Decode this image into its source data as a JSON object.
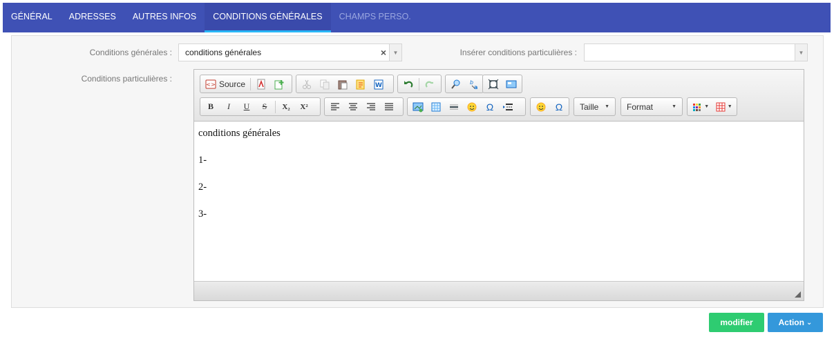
{
  "nav": {
    "tabs": [
      {
        "label": "GÉNÉRAL"
      },
      {
        "label": "ADRESSES"
      },
      {
        "label": "AUTRES INFOS"
      },
      {
        "label": "CONDITIONS GÉNÉRALES"
      },
      {
        "label": "CHAMPS PERSO."
      }
    ],
    "active_tab": "CONDITIONS GÉNÉRALES"
  },
  "form": {
    "cond_generales_label": "Conditions générales :",
    "cond_generales_value": "conditions générales",
    "inserer_label": "Insérer conditions particulières :",
    "inserer_value": "",
    "cond_particulieres_label": "Conditions particulières :"
  },
  "editor": {
    "source_label": "Source",
    "bold": "B",
    "italic": "I",
    "underline": "U",
    "strike": "S",
    "sub": "X₂",
    "sup": "X²",
    "omega": "Ω",
    "size_label": "Taille",
    "format_label": "Format",
    "content": [
      "conditions générales",
      "1-",
      "2-",
      "3-"
    ]
  },
  "footer": {
    "modify_label": "modifier",
    "action_label": "Action"
  },
  "colors": {
    "nav_bg": "#3f51b5",
    "nav_active_indicator": "#29b6f6",
    "modify_btn": "#2ecc71",
    "action_btn": "#3498db"
  }
}
